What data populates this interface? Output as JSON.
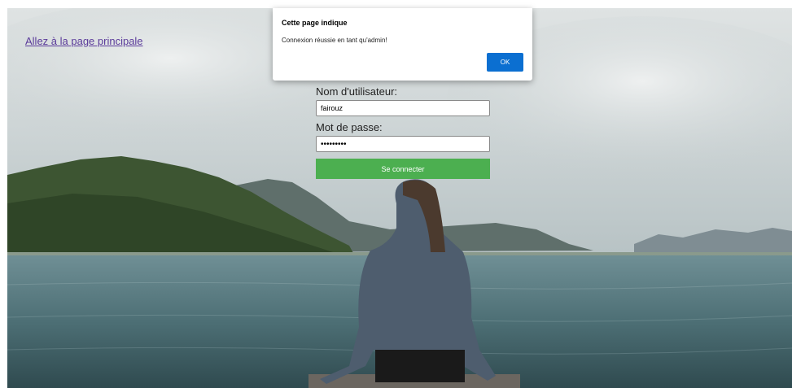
{
  "links": {
    "home": "Allez à la page principale"
  },
  "form": {
    "username_label": "Nom d'utilisateur:",
    "username_value": "fairouz",
    "password_label": "Mot de passe:",
    "password_value": "•••••••••",
    "submit_label": "Se connecter"
  },
  "dialog": {
    "title": "Cette page indique",
    "message": "Connexion réussie en tant qu'admin!",
    "ok_label": "OK"
  },
  "colors": {
    "submit_button": "#4caf50",
    "ok_button": "#0b6fd1",
    "link": "#5b3b9a"
  }
}
